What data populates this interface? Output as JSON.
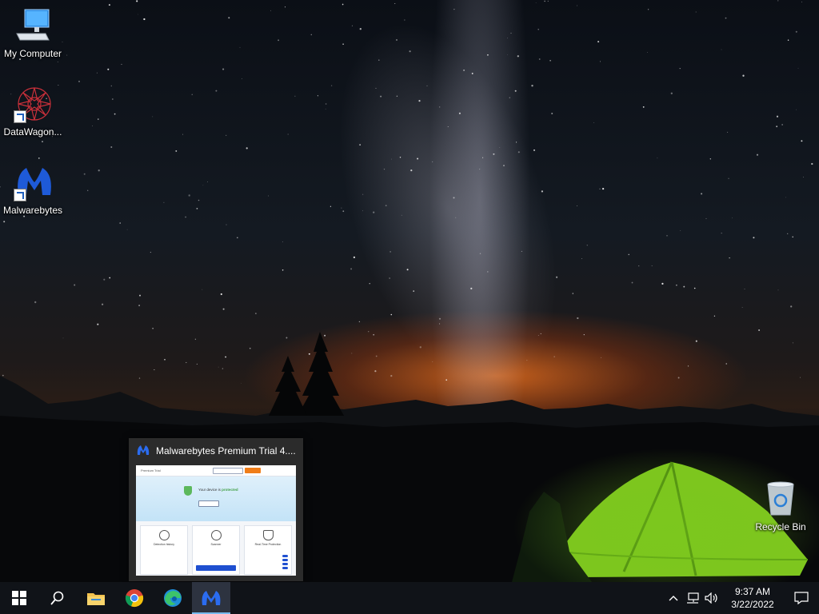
{
  "desktop": {
    "icons": [
      {
        "label": "My Computer",
        "icon": "computer-icon"
      },
      {
        "label": "DataWagon...",
        "icon": "datawagon-icon"
      },
      {
        "label": "Malwarebytes",
        "icon": "malwarebytes-icon"
      },
      {
        "label": "Recycle Bin",
        "icon": "recycle-bin-icon"
      }
    ]
  },
  "preview": {
    "title": "Malwarebytes Premium Trial  4....",
    "thumbnail": {
      "app_name": "Premium Trial",
      "status_prefix": "Your device is ",
      "status_word": "protected",
      "status_color": "#43a047",
      "cards": [
        "Detection history",
        "Scanner",
        "Real-Time Protection"
      ],
      "accent": "#1e4fd0",
      "buy_color": "#f07d18"
    }
  },
  "taskbar": {
    "items": [
      {
        "name": "start-button",
        "icon": "windows-logo-icon"
      },
      {
        "name": "search-button",
        "icon": "search-icon"
      },
      {
        "name": "file-explorer-button",
        "icon": "folder-icon"
      },
      {
        "name": "chrome-button",
        "icon": "chrome-icon"
      },
      {
        "name": "edge-button",
        "icon": "edge-icon"
      },
      {
        "name": "malwarebytes-taskbar-button",
        "icon": "malwarebytes-icon",
        "active": true
      }
    ],
    "tray": {
      "time": "9:37 AM",
      "date": "3/22/2022",
      "icons": [
        "chevron-up-icon",
        "network-icon",
        "volume-icon",
        "notification-icon"
      ]
    }
  }
}
